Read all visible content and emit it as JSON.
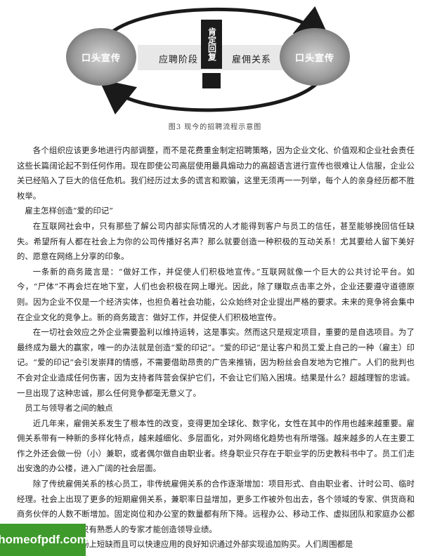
{
  "figure": {
    "left_oval": "口头宣传",
    "right_oval": "口头宣传",
    "stage_left": "应聘阶段",
    "stage_right": "雇佣关系",
    "confirm": "肯定回复",
    "caption": "图3 现今的招聘流程示意图"
  },
  "paragraphs": [
    {
      "text": "各个组织应该更多地进行内部调整，而不是花费重金制定招聘策略，因为企业文化、价值观和企业社会责任这些长篇阔论起不到任何作用。现在即使公司高层使用最具煽动力的高超语言进行宣传也很难让人信服，企业公关已经陷入了巨大的信任危机。我们经历过太多的谎言和欺骗，这里无须再一一列举，每个人的亲身经历都不胜枚举。"
    },
    {
      "text": "雇主怎样创造“爱的印记”",
      "heading": true
    },
    {
      "text": "在互联网社会中，只有那些了解公司内部实际情况的人才能得到客户与员工的信任，甚至能够挽回信任缺失。希望所有人都在社会上为你的公司传播好名声？那么就要创造一种积极的互动关系！尤其要给人留下美好的、愿意在网络上分享的印象。"
    },
    {
      "text": "一条新的商务箴言是：“做好工作，并促使人们积极地宣传。”互联网就像一个巨大的公共讨论平台。如今，“尸体”不再会烂在地下室，人们也会积极在网上曝光。因此，除了赚取点击率之外，企业还要遵守道德原则。因为企业不仅是一个经济实体，也担负着社会功能，公众始终对企业提出严格的要求。未来的竞争将会集中在企业文化的竞争上。新的商务箴言：做好工作，并促使人们积极地宣传。"
    },
    {
      "text": "在一切社会效应之外企业需要盈利以维持运转，这是事实。然而这只是规定项目，重要的是自选项目。为了最终成为最大的赢家，唯一的办法就是创造“爱的印记”。“爱的印记”是让客户和员工爱上自己的一种（雇主）印记。“爱的印记”会引发崇拜的情感，不需要借助昂贵的广告来推销，因为粉丝会自发地为它推广。人们的批判也不会对企业造成任何伤害，因为支持者阵营会保护它们，不会让它们陷入困境。结果是什么？超越理智的忠诚。一旦出现了这种忠诚，那么任何竞争都毫无意义了。"
    },
    {
      "text": "员工与领导者之间的触点",
      "heading": true
    },
    {
      "text": "近几年来，雇佣关系发生了根本性的改变，变得更加全球化、数字化，女性在其中的作用也越来越重要。雇佣关系带有一种新的多样化特点，越来越细化、多层面化，对外网络化趋势也有所增强。越来越多的人在主要工作之外还会做一份（小）兼职，或者偶尔做自由职业者。终身职业只存在于职业学的历史教科书中了。员工们走出安逸的办公楼，进入广阔的社会层面。"
    },
    {
      "text": "除了传统雇佣关系的核心员工，非传统雇佣关系的合作逐渐增加：项目形式、自由职业者、计时公司、临时经理。社会上出现了更多的短期雇佣关系，兼职率日益增加，更多工作被外包出去，各个领域的专家、供货商和商务伙伴的人数不断增加。固定岗位和办公室的数量都有所下降。远程办公、移动工作、虚拟团队和家庭办公都有了长足的发展。只有熟悉人的专家才能创造领导业绩。"
    },
    {
      "text": "思维买单。市场上短缺而且可以快速应用的良好知识通过外部实现追加购买。人们周围都是"
    }
  ],
  "watermark": "homeofpdf.com"
}
